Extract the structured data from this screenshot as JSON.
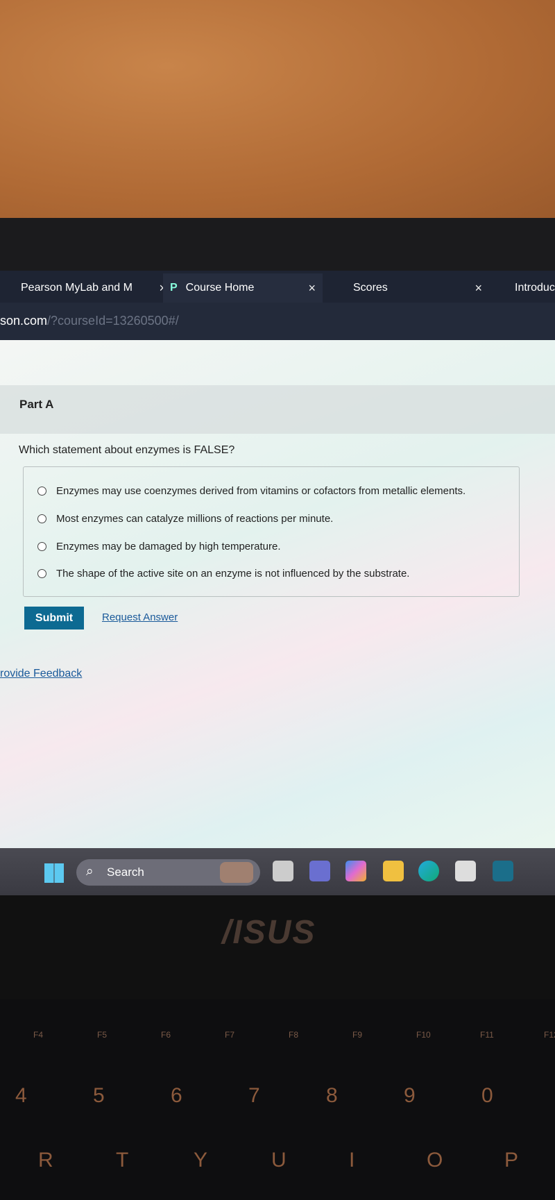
{
  "browser": {
    "tabs": [
      {
        "label": "Pearson MyLab and M",
        "close": "×"
      },
      {
        "label": "Course Home",
        "icon": "pearson-p-icon",
        "icon_glyph": "P",
        "close": "×"
      },
      {
        "label": "Scores",
        "close": "×"
      },
      {
        "label": "Introduc"
      }
    ],
    "url": {
      "host": "son.com",
      "path": "/?courseId=13260500#/"
    }
  },
  "question": {
    "part": "Part A",
    "text": "Which statement about enzymes is FALSE?",
    "options": [
      "Enzymes may use coenzymes derived from vitamins or cofactors from metallic elements.",
      "Most enzymes can catalyze millions of reactions per minute.",
      "Enzymes may be damaged by high temperature.",
      "The shape of the active site on an enzyme is not influenced by the substrate."
    ],
    "submit_label": "Submit",
    "request_answer_label": "Request Answer",
    "feedback_label": "rovide Feedback"
  },
  "taskbar": {
    "search_placeholder": "Search",
    "icons": [
      "windows-start-icon",
      "task-view-icon",
      "teams-icon",
      "copilot-icon",
      "file-explorer-icon",
      "edge-icon",
      "store-icon",
      "disney-plus-icon"
    ]
  },
  "laptop": {
    "brand": "/ISUS"
  },
  "keyboard": {
    "fkeys": [
      "F4",
      "F5",
      "F6",
      "F7",
      "F8",
      "F9",
      "F10",
      "F11",
      "F12"
    ],
    "numbers": [
      "4",
      "5",
      "6",
      "7",
      "8",
      "9",
      "0"
    ],
    "letters": [
      "R",
      "T",
      "Y",
      "U",
      "I",
      "O",
      "P"
    ]
  },
  "colors": {
    "submit": "#0d6a92",
    "link": "#1a5a9a",
    "tabbar": "#1e2433"
  }
}
